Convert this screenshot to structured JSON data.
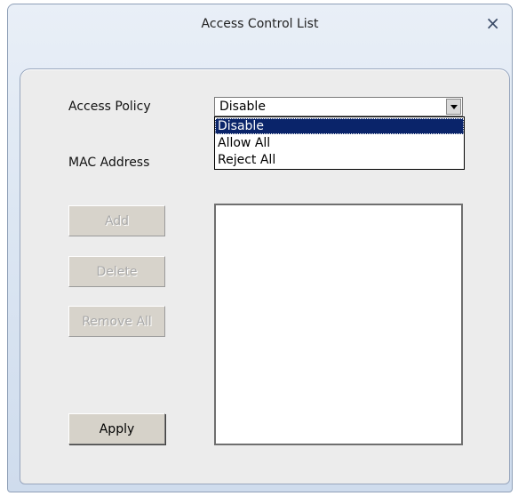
{
  "window": {
    "title": "Access Control List",
    "close_label": "×"
  },
  "form": {
    "access_policy_label": "Access Policy",
    "mac_address_label": "MAC Address",
    "access_policy_value": "Disable",
    "access_policy_options": [
      "Disable",
      "Allow All",
      "Reject All"
    ]
  },
  "buttons": {
    "add": "Add",
    "delete": "Delete",
    "remove_all": "Remove All",
    "apply": "Apply"
  }
}
